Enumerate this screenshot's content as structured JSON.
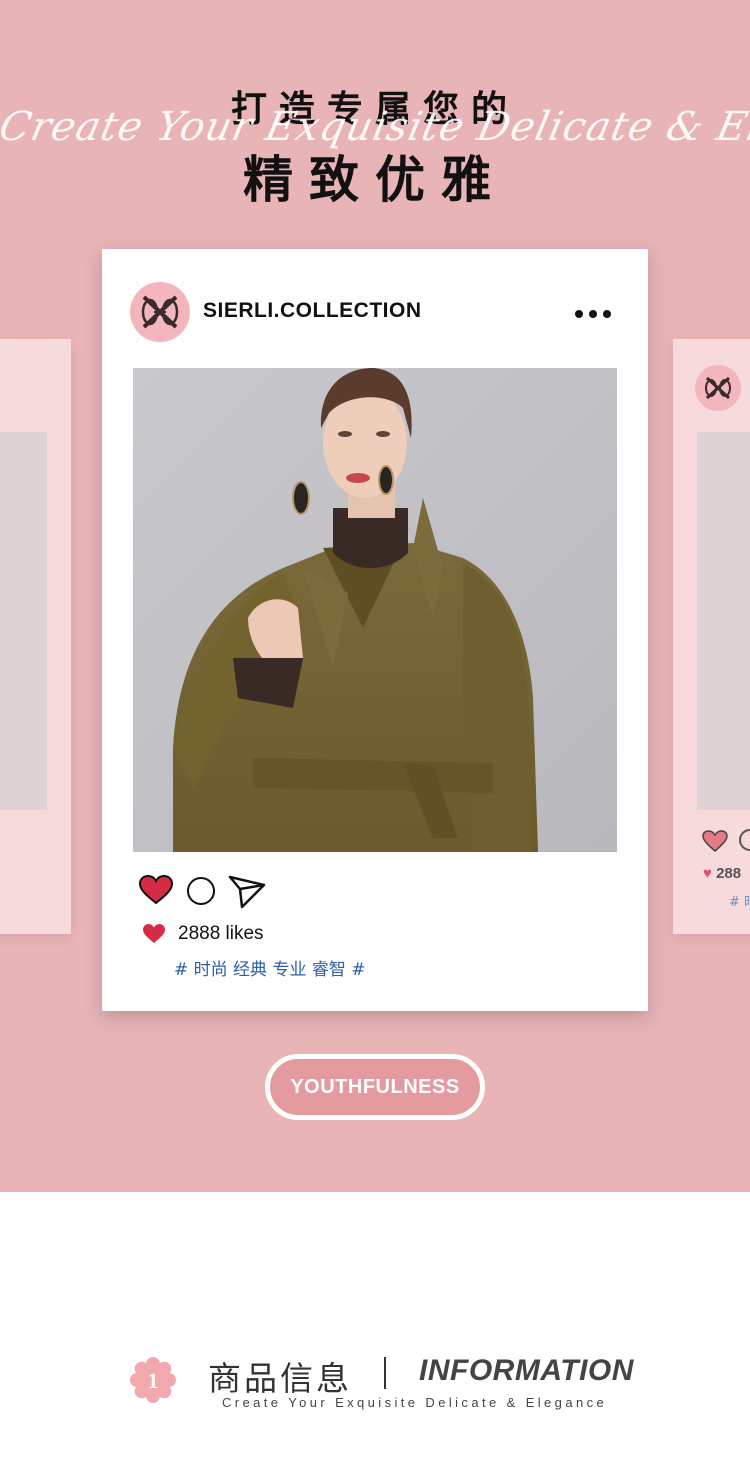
{
  "hero": {
    "headline_top": "打造专属您的",
    "script_line": "Create Your Exquisite Delicate & Elegance",
    "headline_bottom": "精致优雅"
  },
  "post": {
    "username": "SIERLI.COLLECTION",
    "more_icon": "more-horizontal-icon",
    "likes": "2888 likes",
    "hashtags": "# 时尚 经典 专业 睿智 #"
  },
  "side_right": {
    "likes_partial": "288",
    "tag_partial": "# 时"
  },
  "badge": {
    "label": "YOUTHFULNESS"
  },
  "info": {
    "number": "1",
    "title_cn": "商品信息",
    "title_en": "INFORMATION",
    "subtitle": "Create Your Exquisite Delicate & Elegance"
  },
  "colors": {
    "pink_bg": "#e8b4b6",
    "avatar_pink": "#f3b6bd",
    "heart_red": "#d62b45",
    "hashtag_blue": "#2e5fa8"
  }
}
